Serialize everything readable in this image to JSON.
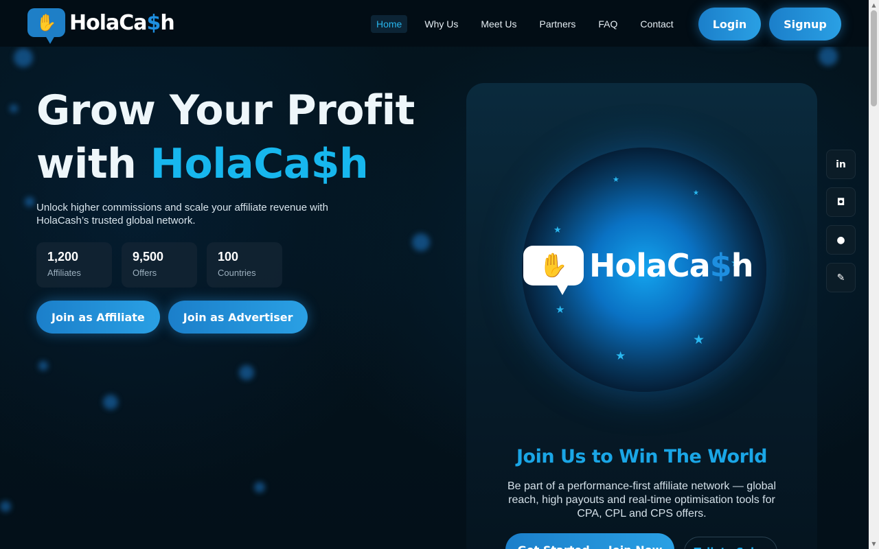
{
  "brand": {
    "name_prefix": "HolaCa",
    "name_dollar": "$",
    "name_suffix": "h"
  },
  "nav": {
    "items": [
      "Home",
      "Why Us",
      "Meet Us",
      "Partners",
      "FAQ",
      "Contact"
    ],
    "active": "Home",
    "login_label": "Login",
    "signup_label": "Signup"
  },
  "hero": {
    "title_line1": "Grow Your Profit",
    "title_line2_prefix": "with ",
    "title_brand": "HolaCa$h",
    "subtitle": "Unlock higher commissions and scale your affiliate revenue with HolaCash’s trusted global network.",
    "stats": [
      {
        "value": "1,200",
        "label": "Affiliates"
      },
      {
        "value": "9,500",
        "label": "Offers"
      },
      {
        "value": "100",
        "label": "Countries"
      }
    ],
    "cta_affiliate": "Join as Affiliate",
    "cta_advertiser": "Join as Advertiser"
  },
  "card": {
    "title": "Join Us to Win The World",
    "description": "Be part of a performance-first affiliate network — global reach, high payouts and real-time optimisation tools for CPA, CPL and CPS offers.",
    "btn_primary": "Get Started — Join Now",
    "btn_secondary": "Talk to Sales"
  },
  "social": [
    {
      "icon": "linkedin-icon",
      "glyph": "in"
    },
    {
      "icon": "instagram-icon",
      "glyph": "◘"
    },
    {
      "icon": "facebook-icon",
      "glyph": "●"
    },
    {
      "icon": "blog-icon",
      "glyph": "✎"
    }
  ],
  "colors": {
    "accent": "#17b7ee",
    "button": "#1b7fca",
    "background": "#03111c"
  }
}
